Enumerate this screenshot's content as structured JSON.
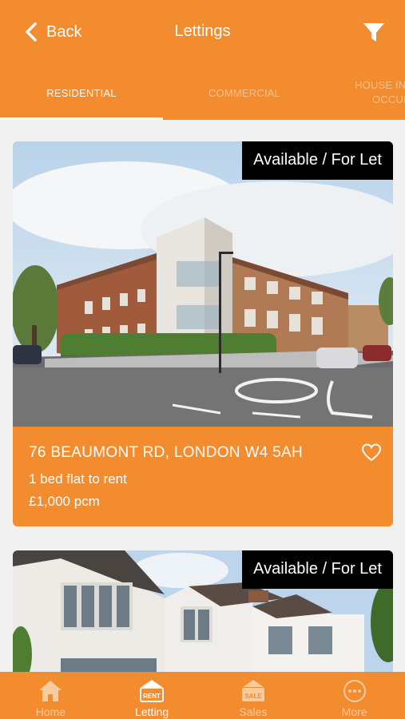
{
  "header": {
    "back_label": "Back",
    "title": "Lettings",
    "tabs": [
      {
        "label": "RESIDENTIAL",
        "active": true
      },
      {
        "label": "COMMERCIAL",
        "active": false
      },
      {
        "label_line1": "HOUSE IN",
        "label_line2": "OCCUP",
        "active": false
      }
    ]
  },
  "listings": [
    {
      "badge": "Available / For Let",
      "address": "76 BEAUMONT RD, LONDON W4 5AH",
      "description": "1 bed flat to rent",
      "price": "£1,000 pcm",
      "favorite": false
    },
    {
      "badge": "Available / For Let"
    }
  ],
  "tabbar": {
    "items": [
      {
        "label": "Home",
        "icon": "home-icon",
        "active": false
      },
      {
        "label": "Letting",
        "icon": "rent-sign-icon",
        "icon_text": "RENT",
        "active": true
      },
      {
        "label": "Sales",
        "icon": "sale-sign-icon",
        "icon_text": "SALE",
        "active": false
      },
      {
        "label": "More",
        "icon": "more-icon",
        "active": false
      }
    ]
  },
  "colors": {
    "brand_orange": "#f28c2e",
    "badge_black": "#000000",
    "text_white": "#ffffff",
    "background": "#f1f1f1"
  }
}
